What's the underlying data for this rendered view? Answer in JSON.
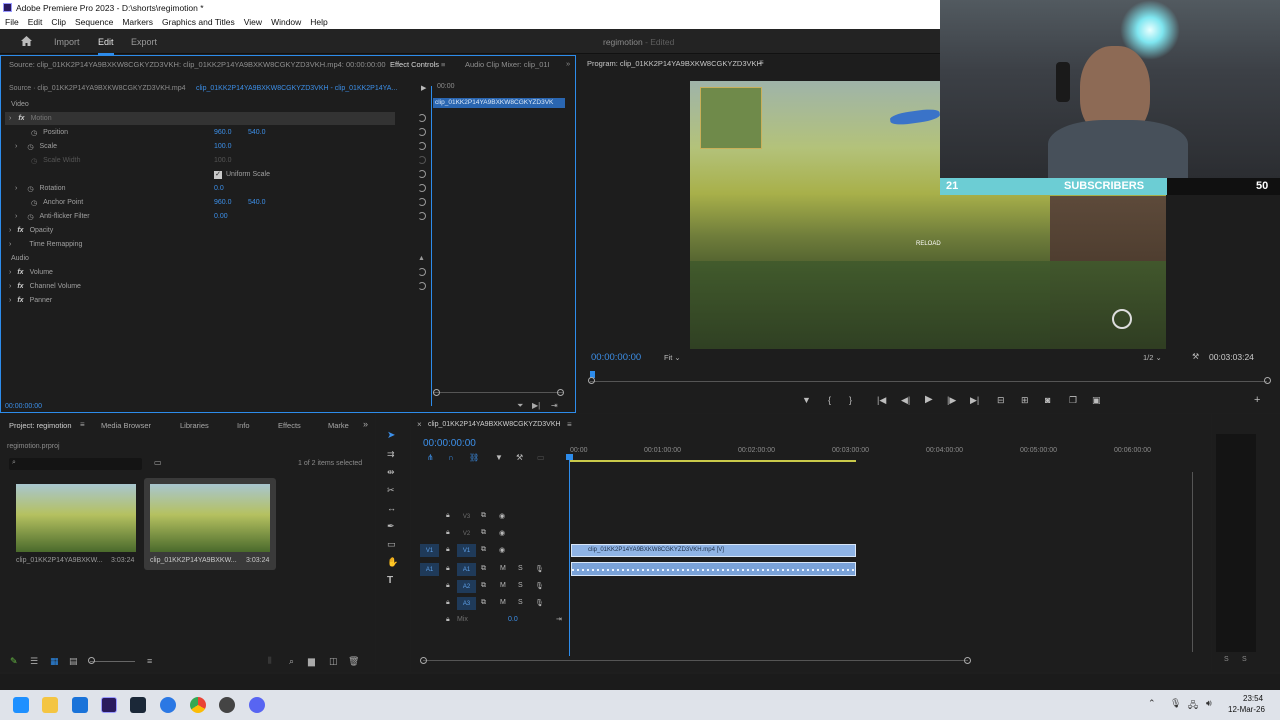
{
  "window": {
    "title": "Adobe Premiere Pro 2023 - D:\\shorts\\regimotion *",
    "menu": [
      "File",
      "Edit",
      "Clip",
      "Sequence",
      "Markers",
      "Graphics and Titles",
      "View",
      "Window",
      "Help"
    ]
  },
  "workspace": {
    "tabs": [
      "Import",
      "Edit",
      "Export"
    ],
    "project_name": "regimotion",
    "project_status": "- Edited"
  },
  "effect_controls": {
    "source_tab": "Source: clip_01KK2P14YA9BXKW8CGKYZD3VKH: clip_01KK2P14YA9BXKW8CGKYZD3VKH.mp4: 00:00:00:00",
    "effect_tab": "Effect Controls",
    "mixer_tab": "Audio Clip Mixer: clip_01I",
    "source_clip": "Source · clip_01KK2P14YA9BXKW8CGKYZD3VKH.mp4",
    "seq_clip": "clip_01KK2P14YA9BXKW8CGKYZD3VKH - clip_01KK2P14YA...",
    "timeline_clip_label": "clip_01KK2P14YA9BXKW8CGKYZD3VK",
    "timeline_time": "00:00",
    "footer_time": "00:00:00:00",
    "section_video": "Video",
    "section_audio": "Audio",
    "motion": "Motion",
    "position_label": "Position",
    "position_x": "960.0",
    "position_y": "540.0",
    "scale_label": "Scale",
    "scale_value": "100.0",
    "scale_width_label": "Scale Width",
    "scale_width_value": "100.0",
    "uniform_scale": "Uniform Scale",
    "rotation_label": "Rotation",
    "rotation_value": "0.0",
    "anchor_label": "Anchor Point",
    "anchor_x": "960.0",
    "anchor_y": "540.0",
    "antiflicker_label": "Anti-flicker Filter",
    "antiflicker_value": "0.00",
    "opacity": "Opacity",
    "time_remap": "Time Remapping",
    "volume": "Volume",
    "channel_volume": "Channel Volume",
    "panner": "Panner"
  },
  "program": {
    "tab": "Program: clip_01KK2P14YA9BXKW8CGKYZD3VKH",
    "timecode": "00:00:00:00",
    "fit": "Fit",
    "resolution": "1/2",
    "duration": "00:03:03:24",
    "hud_reload": "RELOAD"
  },
  "webcam": {
    "sub_count": "21",
    "sub_label": "SUBSCRIBERS",
    "sub_goal": "50"
  },
  "project_panel": {
    "tabs": [
      "Project: regimotion",
      "Media Browser",
      "Libraries",
      "Info",
      "Effects",
      "Marke"
    ],
    "file": "regimotion.prproj",
    "selection": "1 of 2 items selected",
    "items": [
      {
        "name": "clip_01KK2P14YA9BXKW...",
        "duration": "3:03:24"
      },
      {
        "name": "clip_01KK2P14YA9BXKW...",
        "duration": "3:03:24"
      }
    ]
  },
  "timeline": {
    "tab": "clip_01KK2P14YA9BXKW8CGKYZD3VKH",
    "timecode": "00:00:00:00",
    "ruler": [
      "00:00",
      "00:01:00:00",
      "00:02:00:00",
      "00:03:00:00",
      "00:04:00:00",
      "00:05:00:00",
      "00:06:00:00"
    ],
    "tracks_video": [
      "V3",
      "V2",
      "V1"
    ],
    "tracks_audio": [
      "A1",
      "A2",
      "A3"
    ],
    "mix_label": "Mix",
    "mix_value": "0.0",
    "video_clip": "clip_01KK2P14YA9BXKW8CGKYZD3VKH.mp4 [V]",
    "track_m": "M",
    "track_s": "S"
  },
  "meter": {
    "left": "S",
    "right": "S"
  },
  "taskbar": {
    "time": "23:54",
    "date": "12-Mar-26"
  }
}
